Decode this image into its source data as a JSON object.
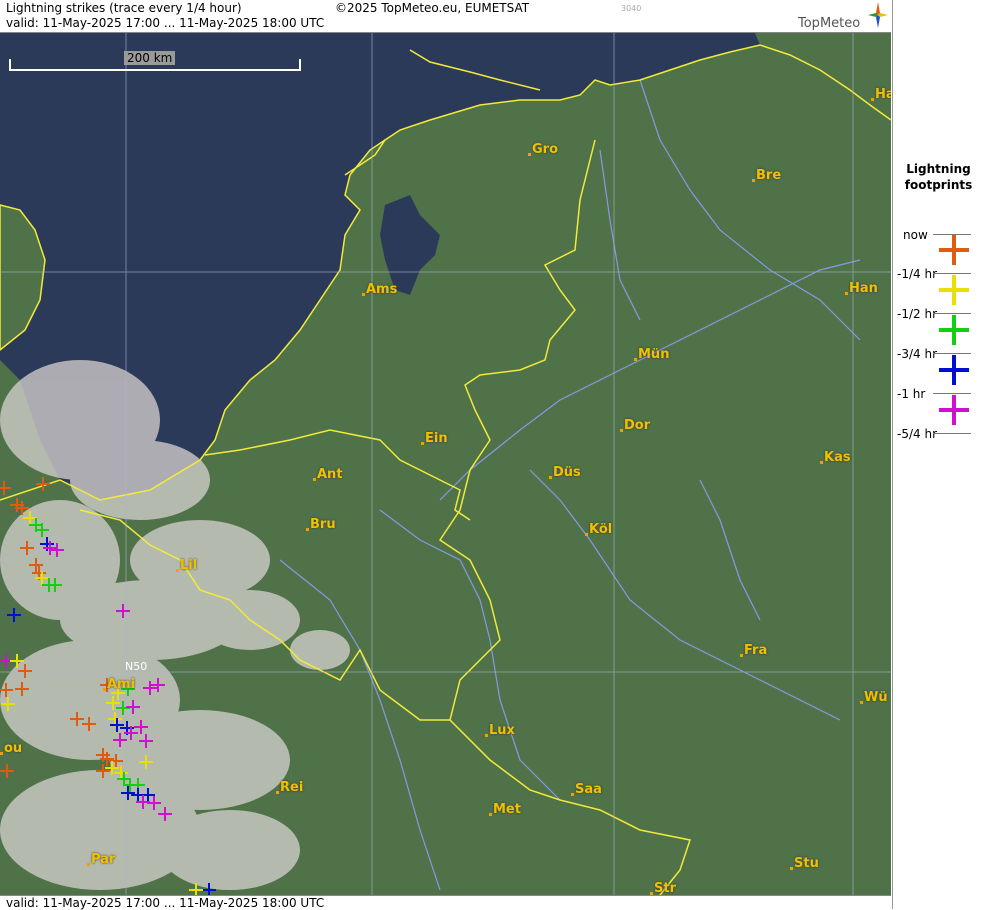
{
  "header": {
    "title": "Lightning strikes (trace every 1/4 hour)",
    "copyright": "©2025 TopMeteo.eu, EUMETSAT",
    "code": "3040",
    "valid": "valid:  11-May-2025 17:00 ... 11-May-2025 18:00 UTC",
    "brand": "TopMeteo"
  },
  "footer": {
    "valid": "valid:  11-May-2025 17:00 ... 11-May-2025 18:00 UTC"
  },
  "map": {
    "scale_label": "200 km",
    "grid_label": "N50",
    "colors": {
      "sea": "#2c3a5a",
      "land": "#4f7248",
      "border": "#f2ea3a",
      "river": "#8fa0ff"
    },
    "cities": [
      {
        "name": "Gro"
      },
      {
        "name": "Bre"
      },
      {
        "name": "Ha"
      },
      {
        "name": "Ams"
      },
      {
        "name": "Han"
      },
      {
        "name": "Mün"
      },
      {
        "name": "Ein"
      },
      {
        "name": "Dor"
      },
      {
        "name": "Kas"
      },
      {
        "name": "Ant"
      },
      {
        "name": "Düs"
      },
      {
        "name": "Bru"
      },
      {
        "name": "Köl"
      },
      {
        "name": "Lil"
      },
      {
        "name": "Fra"
      },
      {
        "name": "Wü"
      },
      {
        "name": "Ami"
      },
      {
        "name": "Lux"
      },
      {
        "name": "ou"
      },
      {
        "name": "Rei"
      },
      {
        "name": "Saa"
      },
      {
        "name": "Met"
      },
      {
        "name": "Par"
      },
      {
        "name": "Stu"
      },
      {
        "name": "Str"
      }
    ]
  },
  "legend": {
    "title_line1": "Lightning",
    "title_line2": "footprints",
    "items": [
      {
        "label": "now",
        "color": ""
      },
      {
        "label": "-1/4 hr",
        "color": "#e05a10"
      },
      {
        "label": "-1/2 hr",
        "color": "#e8e000"
      },
      {
        "label": "-3/4 hr",
        "color": "#10d010"
      },
      {
        "label": "-1 hr",
        "color": "#0010d0"
      },
      {
        "label": "-5/4 hr",
        "color": "#d010d0"
      }
    ]
  }
}
